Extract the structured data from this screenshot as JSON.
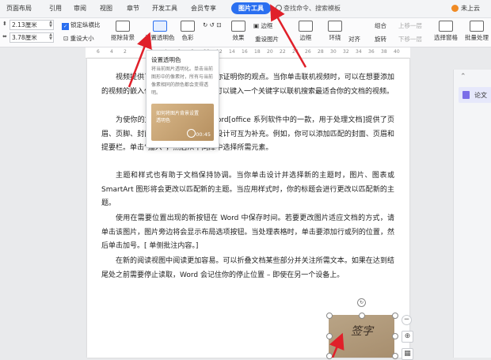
{
  "tabs": [
    "页面布局",
    "引用",
    "审阅",
    "视图",
    "章节",
    "开发工具",
    "会员专享",
    "图片工具"
  ],
  "search": "查找命令、搜索模板",
  "top_right": "未上云",
  "ribbon": {
    "height_value": "2.13厘米",
    "width_value": "3.78厘米",
    "lock_ratio": "锁定纵横比",
    "reset_size": "重设大小",
    "remove_bg": "抠除背景",
    "set_transparent": "设置透明色",
    "color": "色彩",
    "effects": "效果",
    "reset_image": "重设图片",
    "border": "边框",
    "select_text": "选择",
    "wrap": "环绕",
    "align": "对齐",
    "rotate": "旋转",
    "group": "组合",
    "move_up": "上移一层",
    "move_down": "下移一层",
    "selection_pane": "选择窗格",
    "batch": "批量处理"
  },
  "ruler_ticks": [
    "6",
    "4",
    "2",
    "",
    "2",
    "4",
    "6",
    "8",
    "10",
    "12",
    "14",
    "16",
    "18",
    "20",
    "22",
    "24",
    "26",
    "28",
    "30",
    "32",
    "34",
    "36",
    "38",
    "40",
    "42"
  ],
  "tooltip": {
    "title": "设置透明色",
    "desc": "将当前图片透明化。单击当前图形中的像素时，所有与当前像素相同的颜色都会变得透明。",
    "video_title": "如何将图片背景设置透明色",
    "duration": "00:45"
  },
  "document": {
    "paragraphs": [
      "视频提供了功能强大的方法帮助你证明你的观点。当你单击联机视频时，可以在想要添加的视频的嵌入代码中进行粘贴。你也可以键入一个关键字以联机搜索最适合你的文档的视频。",
      "为使你的文档具有专业外观，Word[office 系列软件中的一款，用于处理文档]提供了页眉、页脚、封面和文本框设计，这些设计可互为补充。例如，你可以添加匹配的封面、页眉和提要栏。单击“插入”，然后从不同库中选择所需元素。",
      "主题和样式也有助于文档保持协调。当你单击设计并选择新的主题时，图片、图表或 SmartArt 图形将会更改以匹配新的主题。当应用样式时，你的标题会进行更改以匹配新的主题。",
      "使用在需要位置出现的新按钮在 Word 中保存时间。若要更改图片适应文档的方式，请单击该图片，图片旁边将会显示布局选项按钮。当处理表格时，单击要添加行或列的位置，然后单击加号。[ 单侧批注内容。]",
      "在新的阅读视图中阅读更加容易。可以折叠文档某些部分并关注所需文本。如果在达到结尾处之前需要停止读取，Word 会记住你的停止位置 – 即使在另一个设备上。"
    ]
  },
  "signature_text": "签字",
  "right_panel": {
    "label": "论文"
  }
}
